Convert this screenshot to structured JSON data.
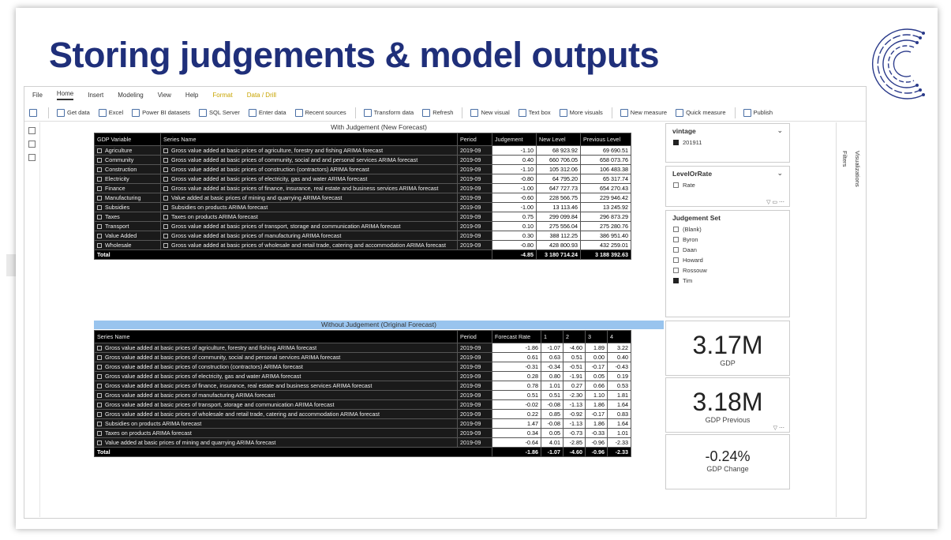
{
  "slide": {
    "title": "Storing judgements & model outputs",
    "nav_left": "‹",
    "nav_right": "›"
  },
  "menu": [
    "File",
    "Home",
    "Insert",
    "Modeling",
    "View",
    "Help",
    "Format",
    "Data / Drill"
  ],
  "ribbon": [
    "Get data",
    "Excel",
    "Power BI datasets",
    "SQL Server",
    "Enter data",
    "Recent sources",
    "Transform data",
    "Refresh",
    "New visual",
    "Text box",
    "More visuals",
    "New measure",
    "Quick measure",
    "Publish"
  ],
  "right_pane": {
    "filters": "Filters",
    "visualizations": "Visualizations"
  },
  "with_judgement": {
    "title": "With Judgement (New Forecast)",
    "headers": [
      "GDP Variable",
      "Series Name",
      "Period",
      "Judgement",
      "New Level",
      "Previous Level"
    ],
    "rows": [
      {
        "var": "Agriculture",
        "series": "Gross value added at basic prices of agriculture, forestry and fishing ARIMA forecast",
        "period": "2019-09",
        "judgement": "-1.10",
        "new": "68 923.92",
        "prev": "69 690.51"
      },
      {
        "var": "Community",
        "series": "Gross value added at basic prices of community, social and and personal services ARIMA forecast",
        "period": "2019-09",
        "judgement": "0.40",
        "new": "660 706.05",
        "prev": "658 073.76"
      },
      {
        "var": "Construction",
        "series": "Gross value added at basic prices of construction (contractors) ARIMA forecast",
        "period": "2019-09",
        "judgement": "-1.10",
        "new": "105 312.06",
        "prev": "106 483.38"
      },
      {
        "var": "Electricity",
        "series": "Gross value added at basic prices of electricity, gas and water ARIMA forecast",
        "period": "2019-09",
        "judgement": "-0.80",
        "new": "64 795.20",
        "prev": "65 317.74"
      },
      {
        "var": "Finance",
        "series": "Gross value added at basic prices of finance, insurance, real estate and business services ARIMA forecast",
        "period": "2019-09",
        "judgement": "-1.00",
        "new": "647 727.73",
        "prev": "654 270.43"
      },
      {
        "var": "Manufacturing",
        "series": "Value added at basic prices of mining and quarrying ARIMA forecast",
        "period": "2019-09",
        "judgement": "-0.60",
        "new": "228 566.75",
        "prev": "229 946.42"
      },
      {
        "var": "Subsidies",
        "series": "Subsidies on products ARIMA forecast",
        "period": "2019-09",
        "judgement": "-1.00",
        "new": "13 113.46",
        "prev": "13 245.92"
      },
      {
        "var": "Taxes",
        "series": "Taxes on products ARIMA forecast",
        "period": "2019-09",
        "judgement": "0.75",
        "new": "299 099.84",
        "prev": "296 873.29"
      },
      {
        "var": "Transport",
        "series": "Gross value added at basic prices of transport, storage and communication ARIMA forecast",
        "period": "2019-09",
        "judgement": "0.10",
        "new": "275 556.04",
        "prev": "275 280.76"
      },
      {
        "var": "Value Added",
        "series": "Gross value added at basic prices of manufacturing ARIMA forecast",
        "period": "2019-09",
        "judgement": "0.30",
        "new": "388 112.25",
        "prev": "386 951.40"
      },
      {
        "var": "Wholesale",
        "series": "Gross value added at basic prices of wholesale and retail trade, catering and accommodation ARIMA forecast",
        "period": "2019-09",
        "judgement": "-0.80",
        "new": "428 800.93",
        "prev": "432 259.01"
      }
    ],
    "total": {
      "label": "Total",
      "judgement": "-4.85",
      "new": "3 180 714.24",
      "prev": "3 188 392.63"
    }
  },
  "without_judgement": {
    "title": "Without Judgement (Original Forecast)",
    "headers": [
      "Series Name",
      "Period",
      "Forecast Rate",
      "1",
      "2",
      "3",
      "4"
    ],
    "rows": [
      {
        "series": "Gross value added at basic prices of agriculture, forestry and fishing ARIMA forecast",
        "period": "2019-09",
        "rate": "-1.86",
        "c1": "-1.07",
        "c2": "-4.60",
        "c3": "1.89",
        "c4": "3.22"
      },
      {
        "series": "Gross value added at basic prices of community, social and personal services ARIMA forecast",
        "period": "2019-09",
        "rate": "0.61",
        "c1": "0.63",
        "c2": "0.51",
        "c3": "0.00",
        "c4": "0.40"
      },
      {
        "series": "Gross value added at basic prices of construction (contractors) ARIMA forecast",
        "period": "2019-09",
        "rate": "-0.31",
        "c1": "-0.34",
        "c2": "-0.51",
        "c3": "-0.17",
        "c4": "-0.43"
      },
      {
        "series": "Gross value added at basic prices of electricity, gas and water ARIMA forecast",
        "period": "2019-09",
        "rate": "0.28",
        "c1": "0.80",
        "c2": "-1.91",
        "c3": "0.05",
        "c4": "0.19"
      },
      {
        "series": "Gross value added at basic prices of finance, insurance, real estate and business services ARIMA forecast",
        "period": "2019-09",
        "rate": "0.78",
        "c1": "1.01",
        "c2": "0.27",
        "c3": "0.66",
        "c4": "0.53"
      },
      {
        "series": "Gross value added at basic prices of manufacturing ARIMA forecast",
        "period": "2019-09",
        "rate": "0.51",
        "c1": "0.51",
        "c2": "-2.30",
        "c3": "1.10",
        "c4": "1.81"
      },
      {
        "series": "Gross value added at basic prices of transport, storage and communication ARIMA forecast",
        "period": "2019-09",
        "rate": "-0.02",
        "c1": "-0.08",
        "c2": "-1.13",
        "c3": "1.86",
        "c4": "1.64"
      },
      {
        "series": "Gross value added at basic prices of wholesale and retail trade, catering and accommodation ARIMA forecast",
        "period": "2019-09",
        "rate": "0.22",
        "c1": "0.85",
        "c2": "-0.92",
        "c3": "-0.17",
        "c4": "0.83"
      },
      {
        "series": "Subsidies on products ARIMA forecast",
        "period": "2019-09",
        "rate": "1.47",
        "c1": "-0.08",
        "c2": "-1.13",
        "c3": "1.86",
        "c4": "1.64"
      },
      {
        "series": "Taxes on products ARIMA forecast",
        "period": "2019-09",
        "rate": "0.34",
        "c1": "0.05",
        "c2": "-0.73",
        "c3": "-0.33",
        "c4": "1.01"
      },
      {
        "series": "Value added at basic prices of mining and quarrying ARIMA forecast",
        "period": "2019-09",
        "rate": "-0.64",
        "c1": "4.01",
        "c2": "-2.85",
        "c3": "-0.96",
        "c4": "-2.33"
      }
    ],
    "total": {
      "label": "Total",
      "rate": "-1.86",
      "c1": "-1.07",
      "c2": "-4.60",
      "c3": "-0.96",
      "c4": "-2.33"
    }
  },
  "slicers": {
    "vintage": {
      "title": "vintage",
      "options": [
        {
          "label": "201911",
          "checked": true
        }
      ]
    },
    "level_or_rate": {
      "title": "LevelOrRate",
      "options": [
        {
          "label": "Rate",
          "checked": false
        }
      ]
    },
    "judgement_set": {
      "title": "Judgement Set",
      "options": [
        {
          "label": "(Blank)",
          "checked": false
        },
        {
          "label": "Byron",
          "checked": false
        },
        {
          "label": "Daan",
          "checked": false
        },
        {
          "label": "Howard",
          "checked": false
        },
        {
          "label": "Rossouw",
          "checked": false
        },
        {
          "label": "Tim",
          "checked": true
        }
      ]
    }
  },
  "cards": {
    "gdp": {
      "value": "3.17M",
      "label": "GDP"
    },
    "gdp_previous": {
      "value": "3.18M",
      "label": "GDP Previous"
    },
    "gdp_change": {
      "value": "-0.24%",
      "label": "GDP Change"
    }
  },
  "colors": {
    "title": "#1f2f7a",
    "table_bg": "#1a1a1a",
    "header_band": "#99c4ee"
  }
}
